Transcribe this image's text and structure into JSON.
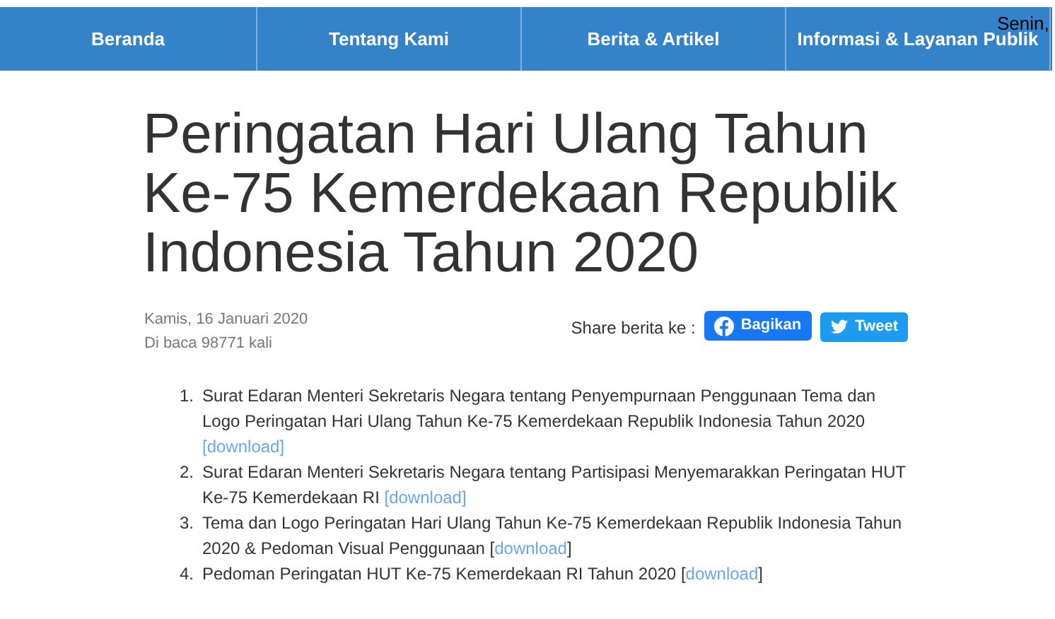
{
  "nav": [
    {
      "label": "Beranda"
    },
    {
      "label": "Tentang Kami"
    },
    {
      "label": "Berita & Artikel"
    },
    {
      "label": "Informasi & Layanan Publik"
    }
  ],
  "date_overlay": "Senin,",
  "title": "Peringatan Hari Ulang Tahun Ke-75 Kemerdekaan Republik Indonesia Tahun 2020",
  "meta": {
    "date": "Kamis, 16 Januari 2020",
    "views": "Di baca 98771 kali"
  },
  "share": {
    "label": "Share berita ke :",
    "buttons": [
      {
        "kind": "facebook",
        "label": "Bagikan"
      },
      {
        "kind": "twitter",
        "label": "Tweet"
      }
    ]
  },
  "documents": [
    {
      "number": "1.",
      "text": "Surat Edaran Menteri Sekretaris Negara tentang Penyempurnaan Penggunaan Tema dan Logo Peringatan Hari Ulang Tahun Ke-75 Kemerdekaan Republik Indonesia Tahun 2020 ",
      "link": "[download]"
    },
    {
      "number": "2.",
      "text": "Surat Edaran Menteri Sekretaris Negara tentang Partisipasi Menyemarakkan Peringatan HUT Ke-75 Kemerdekaan RI ",
      "link": "[download]"
    },
    {
      "number": "3.",
      "text": "Tema dan Logo Peringatan Hari Ulang Tahun Ke-75 Kemerdekaan Republik Indonesia Tahun 2020 & Pedoman Visual Penggunaan [",
      "link": "download",
      "after": "]"
    },
    {
      "number": "4.",
      "text": "Pedoman Peringatan HUT Ke-75 Kemerdekaan RI Tahun 2020 [",
      "link": "download",
      "after": "]"
    }
  ]
}
